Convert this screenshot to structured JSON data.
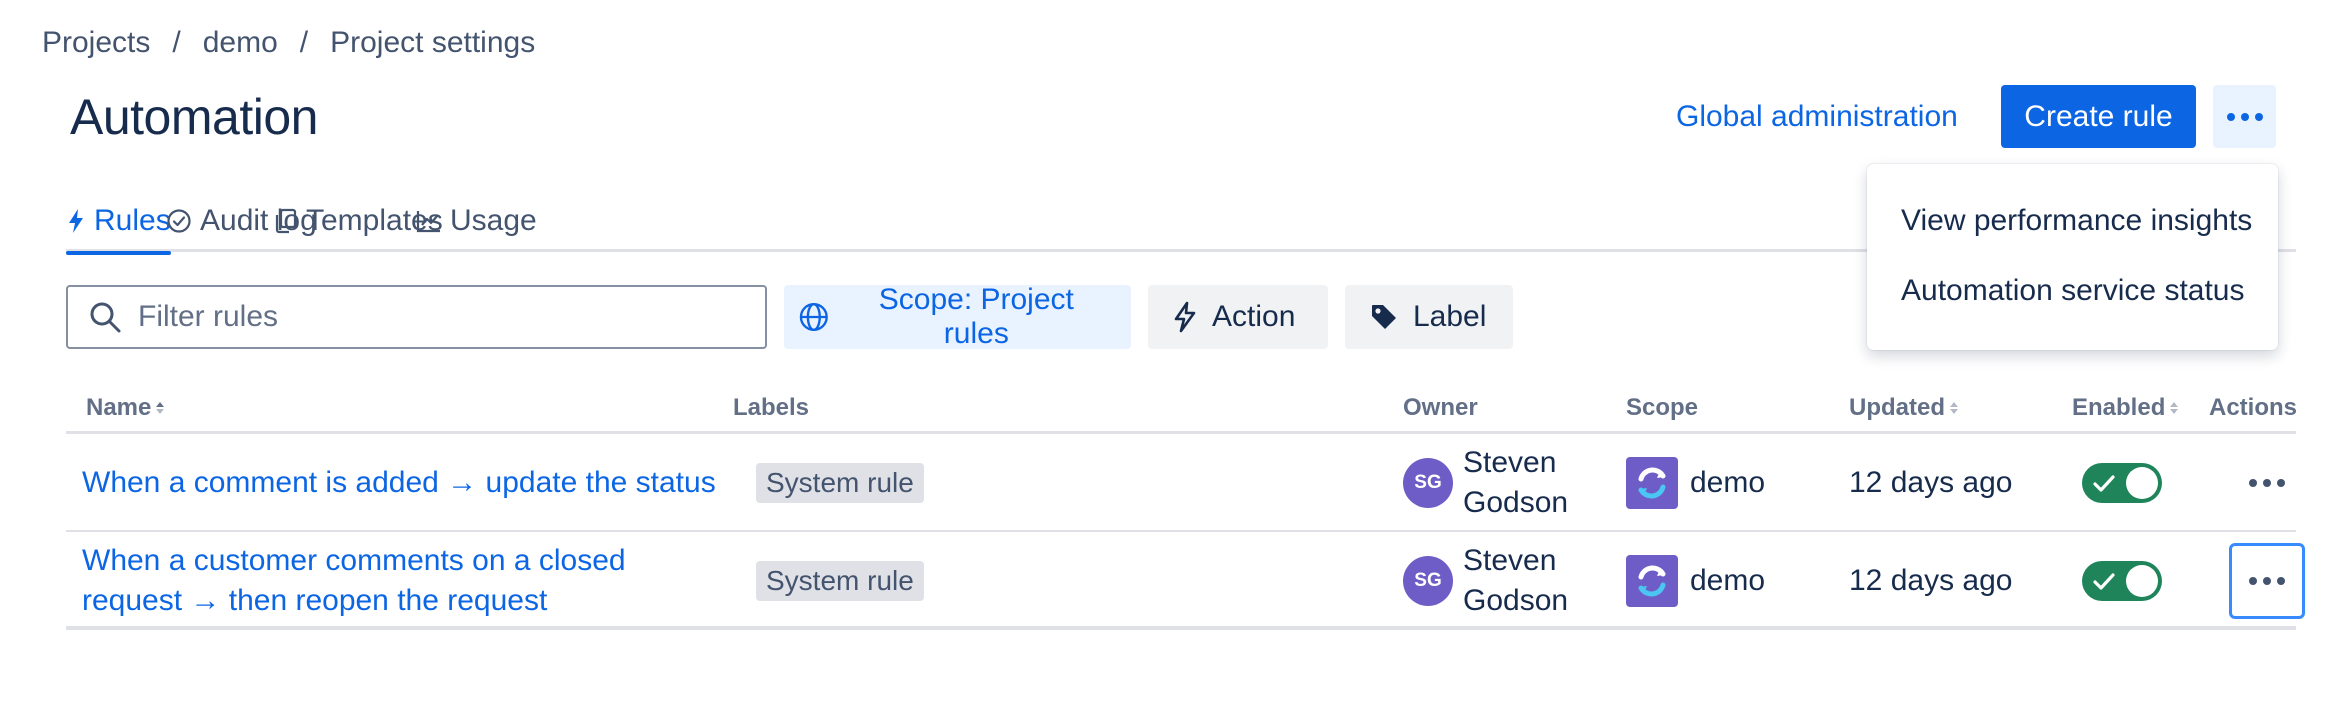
{
  "breadcrumb": {
    "items": [
      "Projects",
      "demo",
      "Project settings"
    ],
    "separator": "/"
  },
  "page_title": "Automation",
  "header": {
    "global_admin_label": "Global administration",
    "create_rule_label": "Create rule",
    "more_icon": "ellipsis-icon"
  },
  "tabs": [
    {
      "label": "Rules",
      "icon": "lightning-icon",
      "active": true
    },
    {
      "label": "Audit log",
      "icon": "check-circle-icon",
      "active": false
    },
    {
      "label": "Templates",
      "icon": "copy-icon",
      "active": false
    },
    {
      "label": "Usage",
      "icon": "chart-line-icon",
      "active": false
    }
  ],
  "filter": {
    "placeholder": "Filter rules",
    "value": ""
  },
  "chips": {
    "scope_label": "Scope: Project rules",
    "action_label": "Action",
    "label_label": "Label"
  },
  "dropdown": {
    "items": [
      "View performance insights",
      "Automation service status"
    ]
  },
  "table": {
    "headers": {
      "name": "Name",
      "labels": "Labels",
      "owner": "Owner",
      "scope": "Scope",
      "updated": "Updated",
      "enabled": "Enabled",
      "actions": "Actions"
    },
    "rows": [
      {
        "name": "When a comment is added → update the status",
        "label": "System rule",
        "owner_initials": "SG",
        "owner_first": "Steven",
        "owner_last": "Godson",
        "scope": "demo",
        "updated": "12 days ago",
        "enabled": true
      },
      {
        "name_line1": "When a customer comments on a closed",
        "name_line2": "request → then reopen the request",
        "label": "System rule",
        "owner_initials": "SG",
        "owner_first": "Steven",
        "owner_last": "Godson",
        "scope": "demo",
        "updated": "12 days ago",
        "enabled": true
      }
    ]
  },
  "colors": {
    "primary": "#0c66e4",
    "toggle_on": "#1f845a",
    "avatar": "#6e5dc6",
    "text": "#172b4d",
    "subtle_text": "#44546f"
  }
}
